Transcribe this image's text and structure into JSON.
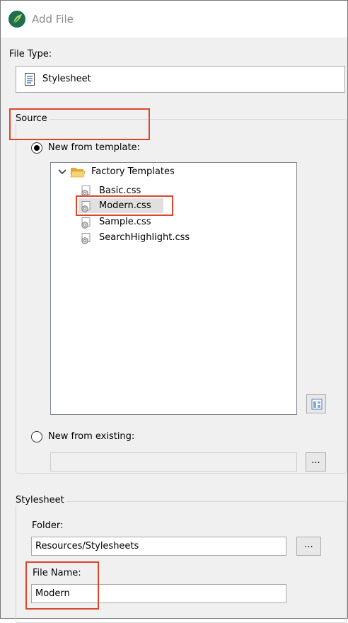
{
  "window": {
    "title": "Add File"
  },
  "file_type": {
    "label": "File Type:",
    "value": "Stylesheet",
    "icon": "document-icon"
  },
  "source": {
    "title": "Source",
    "new_from_template_label": "New from template:",
    "new_from_template_selected": true,
    "tree": {
      "folder": "Factory Templates",
      "items": [
        "Basic.css",
        "Modern.css",
        "Sample.css",
        "SearchHighlight.css"
      ],
      "selected": "Modern.css"
    },
    "new_from_existing_label": "New from existing:",
    "new_from_existing_selected": false,
    "existing_path": "",
    "browse_label": "..."
  },
  "stylesheet": {
    "title": "Stylesheet",
    "folder_label": "Folder:",
    "folder_value": "Resources/Stylesheets",
    "browse_label": "...",
    "file_name_label": "File Name:",
    "file_name_value": "Modern"
  },
  "colors": {
    "highlight": "#d9472b",
    "app_icon": "#1f7a57",
    "folder": "#e8b84a"
  }
}
